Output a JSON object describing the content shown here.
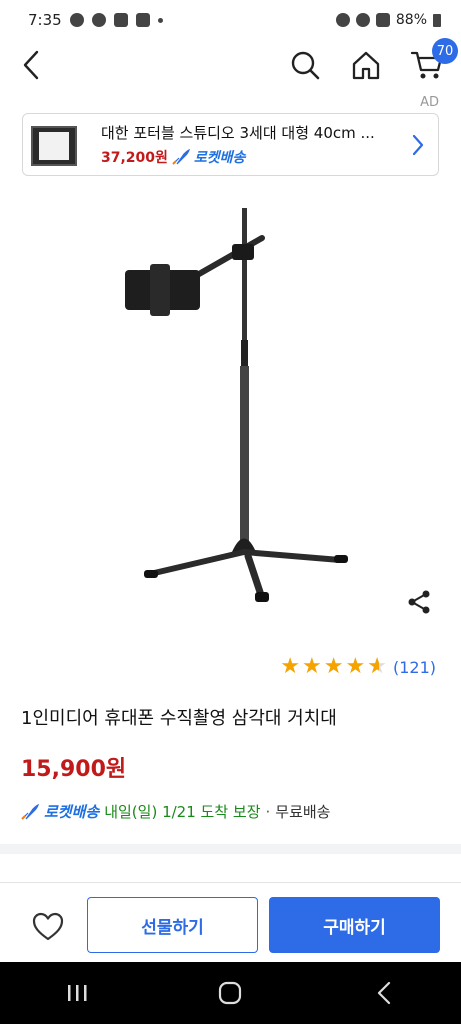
{
  "status_bar": {
    "time": "7:35",
    "battery": "88%"
  },
  "top_nav": {
    "cart_count": "70"
  },
  "ad": {
    "label": "AD",
    "title": "대한 포터블 스튜디오 3세대 대형 40cm ...",
    "price": "37,200원",
    "rocket_label": "로켓배송"
  },
  "product": {
    "rating_value": 4.5,
    "review_count": "(121)",
    "title": "1인미디어 휴대폰 수직촬영 삼각대 거치대",
    "price": "15,900원"
  },
  "delivery": {
    "rocket_label": "로켓배송",
    "info": "내일(일) 1/21 도착 보장",
    "separator": "·",
    "free_shipping": "무료배송"
  },
  "actions": {
    "gift_label": "선물하기",
    "buy_label": "구매하기"
  },
  "colors": {
    "accent_blue": "#2e6be6",
    "price_red": "#c11a1a",
    "star": "#f5a300",
    "delivery_green": "#1a8a1a"
  }
}
